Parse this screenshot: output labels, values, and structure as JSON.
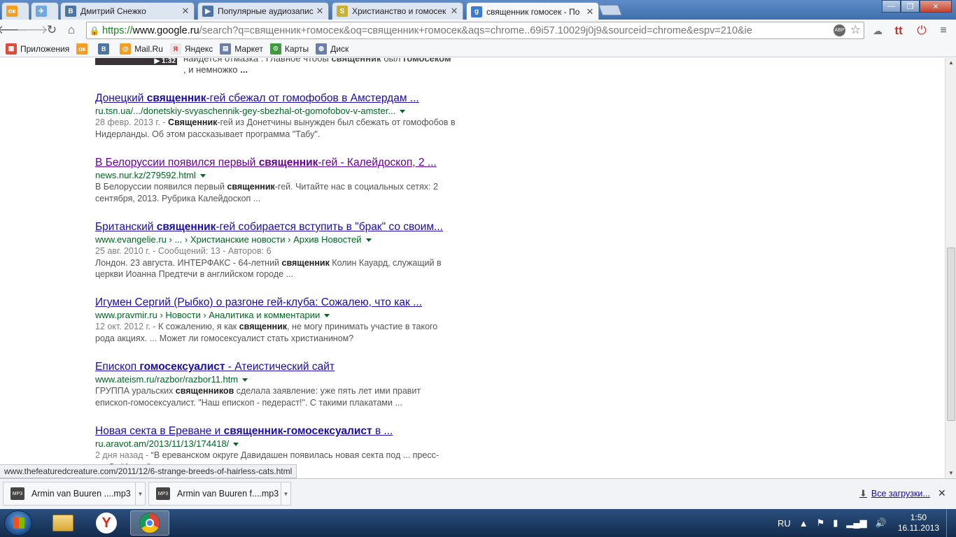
{
  "tabs": [
    {
      "label": "",
      "icon": "odnoklassniki-icon",
      "color": "#f59e21",
      "glyph": "ок"
    },
    {
      "label": "",
      "icon": "twitter-icon",
      "color": "#6fa8dc",
      "glyph": "t"
    },
    {
      "label": "Дмитрий Снежко",
      "icon": "vk-icon",
      "color": "#4c75a3",
      "glyph": "B"
    },
    {
      "label": "Популярные аудиозапис",
      "icon": "vk-icon",
      "color": "#4c75a3",
      "glyph": "▶"
    },
    {
      "label": "Христианство и гомосек",
      "icon": "s-icon",
      "color": "#c9b037",
      "glyph": "S"
    },
    {
      "label": "священник гомосек - По",
      "icon": "google-icon",
      "color": "#3b7bd8",
      "glyph": "g"
    }
  ],
  "window": {
    "minimize": "—",
    "maximize": "❐",
    "close": "✕"
  },
  "omnibox": {
    "scheme": "https://",
    "host": "www.google.ru",
    "path": "/search?q=священник+гомосек&oq=священник+гомосек&aqs=chrome..69i57.10029j0j9&sourceid=chrome&espv=210&ie",
    "abp_label": "ABP"
  },
  "bookmarks": [
    {
      "label": "Приложения",
      "icon": "apps-grid-icon",
      "color": "#e04c3c",
      "glyph": "▦"
    },
    {
      "label": "",
      "icon": "odnoklassniki-icon",
      "color": "#f59e21",
      "glyph": "ок"
    },
    {
      "label": "",
      "icon": "vk-icon",
      "color": "#4c75a3",
      "glyph": "B"
    },
    {
      "label": "Mail.Ru",
      "icon": "mailru-icon",
      "color": "#f0a020",
      "glyph": "@"
    },
    {
      "label": "Яндекс",
      "icon": "yandex-icon",
      "color": "#e8e8e8",
      "glyph": "Я"
    },
    {
      "label": "Маркет",
      "icon": "market-icon",
      "color": "#6b7fa6",
      "glyph": "▤"
    },
    {
      "label": "Карты",
      "icon": "maps-icon",
      "color": "#3e9a3e",
      "glyph": "⊙"
    },
    {
      "label": "Диск",
      "icon": "disk-icon",
      "color": "#6b7fa6",
      "glyph": "◍"
    }
  ],
  "video_result": {
    "duration": "▶ 1:32",
    "snippet_pre": "найдется отмазка . Главное чтобы ",
    "snippet_b1": "священник",
    "snippet_mid": " был ",
    "snippet_b2": "гомосеком",
    "snippet_post": ", и немножко ",
    "snippet_ell": "..."
  },
  "results": [
    {
      "t1": "Донецкий ",
      "tb": "священник",
      "t2": "-гей сбежал от гомофобов в Амстердам ...",
      "url": "ru.tsn.ua/.../donetskiy-svyaschennik-gey-sbezhal-ot-gomofobov-v-amster...",
      "date": "28 февр. 2013 г. - ",
      "s1": "",
      "sb": "Священник",
      "s2": "-гей из Донетчины вынужден был сбежать от гомофобов в Нидерланды. Об этом рассказывает программа \"Табу\".",
      "visited": false
    },
    {
      "t1": "В Белоруссии появился первый ",
      "tb": "священник",
      "t2": "-гей - Калейдоскоп, 2 ...",
      "url": "news.nur.kz/279592.html",
      "date": "",
      "s1": "В Белоруссии появился первый ",
      "sb": "священник",
      "s2": "-гей. Читайте нас в социальных сетях: 2 сентября, 2013. Рубрика Калейдоскоп ...",
      "visited": true
    },
    {
      "t1": "Британский ",
      "tb": "священник",
      "t2": "-гей собирается вступить в \"брак\" со своим...",
      "url": "www.evangelie.ru › ... › Христианские новости › Архив Новостей",
      "date": "25 авг. 2010 г. - Сообщений: 13 - Авторов: 6",
      "s1": "Лондон. 23 августа. ИНТЕРФАКС - 64-летний ",
      "sb": "священник",
      "s2": " Колин Кауард, служащий в церкви Иоанна Предтечи в английском городе ...",
      "visited": false
    },
    {
      "t1": "Игумен Сергий (Рыбко) о разгоне гей-клуба: Сожалею, что как ...",
      "tb": "",
      "t2": "",
      "url": "www.pravmir.ru › Новости › Аналитика и комментарии",
      "date": "12 окт. 2012 г. - ",
      "s1": "К сожалению, я как ",
      "sb": "священник",
      "s2": ", не могу принимать участие в такого рода акциях. ... Может ли гомосексуалист стать христианином?",
      "visited": false
    },
    {
      "t1": "Епископ ",
      "tb": "гомосексуалист",
      "t2": " - Атеистический сайт",
      "url": "www.ateism.ru/razbor/razbor11.htm",
      "date": "",
      "s1": "ГРУППА уральских ",
      "sb": "священников",
      "s2": " сделала заявление: уже пять лет ими правит епископ-гомосексуалист. \"Наш епископ - педераст!\". С такими плакатами ...",
      "visited": false
    },
    {
      "t1": "Новая секта в Ереване и ",
      "tb": "священник-гомосексуалист",
      "t2": " в ...",
      "url": "ru.aravot.am/2013/11/13/174418/",
      "date": "2 дня назад - ",
      "s1": "“В ереванском округе Давидашен появилась новая секта под ",
      "sb": "",
      "s2": "... пресс-клубе “Аздак” ...",
      "visited": false
    }
  ],
  "status_url": "www.thefeaturedcreature.com/2011/12/6-strange-breeds-of-hairless-cats.html",
  "downloads": [
    {
      "name": "Armin van Buuren ....mp3",
      "icon_label": "MP3"
    },
    {
      "name": "Armin van Buuren f....mp3",
      "icon_label": "MP3"
    }
  ],
  "downloads_all": "Все загрузки...",
  "taskbar": {
    "lang": "RU",
    "time": "1:50",
    "date": "16.11.2013"
  }
}
